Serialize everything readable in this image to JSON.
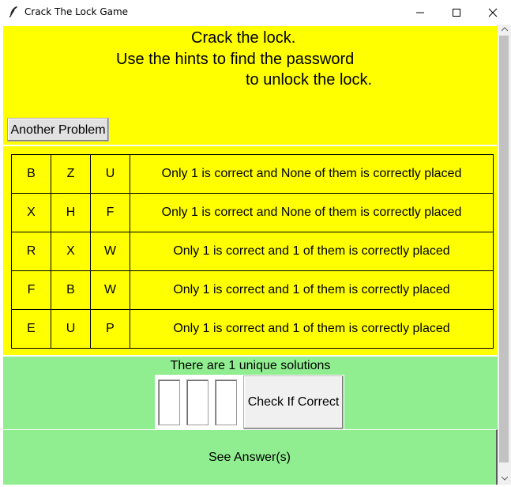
{
  "window": {
    "title": "Crack The Lock Game"
  },
  "header": {
    "line1": "Crack the lock.",
    "line2": "Use the hints to find the password",
    "line3": "to unlock the lock.",
    "another_button": "Another Problem",
    "background": "#ffff00"
  },
  "hints": [
    {
      "letters": [
        "B",
        "Z",
        "U"
      ],
      "text": "Only 1 is correct and None of them is correctly placed"
    },
    {
      "letters": [
        "X",
        "H",
        "F"
      ],
      "text": "Only 1 is correct and None of them is correctly placed"
    },
    {
      "letters": [
        "R",
        "X",
        "W"
      ],
      "text": "Only 1 is correct and 1 of them is correctly placed"
    },
    {
      "letters": [
        "F",
        "B",
        "W"
      ],
      "text": "Only 1 is correct and 1 of them is correctly placed"
    },
    {
      "letters": [
        "E",
        "U",
        "P"
      ],
      "text": "Only 1 is correct and 1 of them is correctly placed"
    }
  ],
  "answer": {
    "solutions_text": "There are 1 unique solutions",
    "digit_values": [
      "",
      "",
      ""
    ],
    "check_button": "Check If Correct",
    "see_button": "See Answer(s)",
    "background": "#90ee90"
  },
  "icons": {
    "app": "feather-icon",
    "minimize": "minimize-icon",
    "maximize": "maximize-icon",
    "close": "close-icon"
  }
}
